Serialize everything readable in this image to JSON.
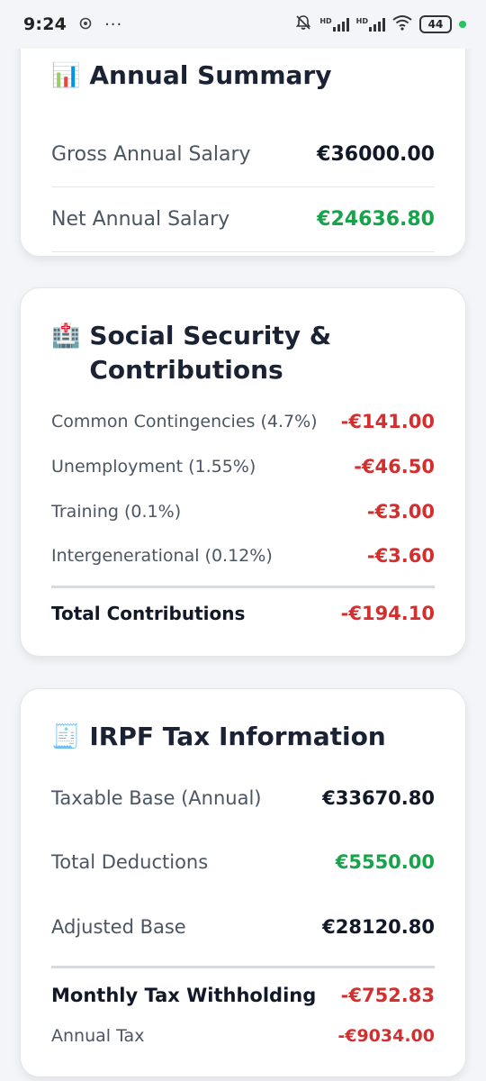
{
  "status_bar": {
    "time": "9:24",
    "dots": "···",
    "battery": "44"
  },
  "annual_summary": {
    "icon": "📊",
    "title": "Annual Summary",
    "rows": [
      {
        "label": "Gross Annual Salary",
        "value": "€36000.00"
      },
      {
        "label": "Net Annual Salary",
        "value": "€24636.80"
      }
    ]
  },
  "social_security": {
    "icon": "🏥",
    "title": "Social Security & Contributions",
    "rows": [
      {
        "label": "Common Contingencies (4.7%)",
        "value": "-€141.00"
      },
      {
        "label": "Unemployment (1.55%)",
        "value": "-€46.50"
      },
      {
        "label": "Training (0.1%)",
        "value": "-€3.00"
      },
      {
        "label": "Intergenerational (0.12%)",
        "value": "-€3.60"
      }
    ],
    "total": {
      "label": "Total Contributions",
      "value": "-€194.10"
    }
  },
  "irpf": {
    "icon": "🧾",
    "title": "IRPF Tax Information",
    "rows": [
      {
        "label": "Taxable Base (Annual)",
        "value": "€33670.80"
      },
      {
        "label": "Total Deductions",
        "value": "€5550.00"
      },
      {
        "label": "Adjusted Base",
        "value": "€28120.80"
      }
    ],
    "monthly": {
      "label": "Monthly Tax Withholding",
      "value": "-€752.83"
    },
    "annual": {
      "label": "Annual Tax",
      "value": "-€9034.00"
    }
  },
  "colors": {
    "negative": "#d32f2f",
    "positive": "#16a34a",
    "text": "#1f2937",
    "card_bg": "#ffffff",
    "page_bg": "#f3f5f8"
  }
}
